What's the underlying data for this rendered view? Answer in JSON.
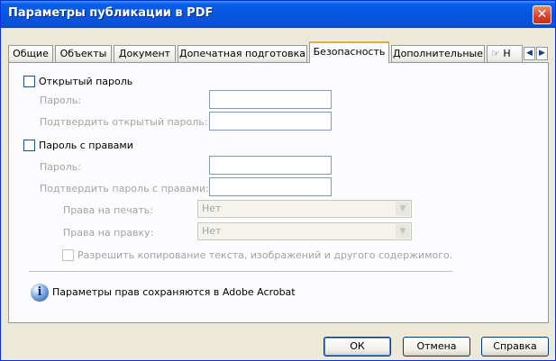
{
  "window": {
    "title": "Параметры публикации в PDF",
    "close_glyph": "✕"
  },
  "tabs": [
    {
      "label": "Общие",
      "active": false
    },
    {
      "label": "Объекты",
      "active": false
    },
    {
      "label": "Документ",
      "active": false
    },
    {
      "label": "Допечатная подготовка",
      "active": false
    },
    {
      "label": "Безопасность",
      "active": true
    },
    {
      "label": "Дополнительные",
      "active": false
    },
    {
      "label": "Н",
      "active": false
    }
  ],
  "tab_scroll": {
    "left": "◀",
    "right": "▶"
  },
  "open_password": {
    "checkbox_label": "Открытый пароль",
    "password_label": "Пароль:",
    "confirm_label": "Подтвердить открытый пароль:",
    "password_value": "",
    "confirm_value": ""
  },
  "rights_password": {
    "checkbox_label": "Пароль с правами",
    "password_label": "Пароль:",
    "confirm_label": "Подтвердить пароль с правами:",
    "password_value": "",
    "confirm_value": "",
    "print_label": "Права на печать:",
    "print_value": "Нет",
    "edit_label": "Права на правку:",
    "edit_value": "Нет",
    "copy_label": "Разрешить копирование текста, изображений и другого содержимого."
  },
  "info": {
    "icon": "info-icon",
    "text": "Параметры прав сохраняются в Adobe Acrobat"
  },
  "buttons": {
    "ok": "ОК",
    "cancel": "Отмена",
    "help": "Справка"
  }
}
